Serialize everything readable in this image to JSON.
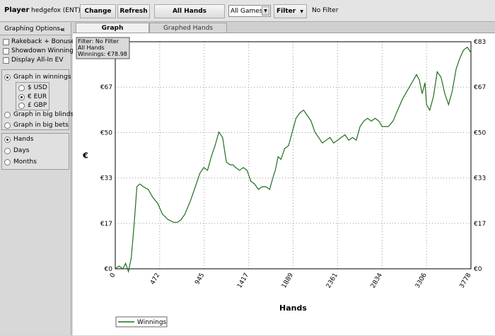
{
  "toolbar": {
    "player_label": "Player",
    "player_name": "hedgefox (ENT)",
    "change_label": "Change",
    "refresh_label": "Refresh",
    "hands_label": "All Hands",
    "games_select": "All Games",
    "filter_label": "Filter",
    "filter_status": "No Filter"
  },
  "sidebar": {
    "header": "Graphing Options",
    "collapse": "«",
    "checkboxes": [
      "Rakeback + Bonuses",
      "Showdown Winnings",
      "Display All-In EV"
    ],
    "graph_in": [
      {
        "label": "Graph in winnings",
        "selected": true
      },
      {
        "label": "Graph in big blinds",
        "selected": false
      },
      {
        "label": "Graph in big bets",
        "selected": false
      }
    ],
    "currency": [
      {
        "label": "$ USD",
        "selected": false
      },
      {
        "label": "€ EUR",
        "selected": true
      },
      {
        "label": "£ GBP",
        "selected": false
      }
    ],
    "period": [
      {
        "label": "Hands",
        "selected": true
      },
      {
        "label": "Days",
        "selected": false
      },
      {
        "label": "Months",
        "selected": false
      }
    ]
  },
  "tabs": [
    {
      "label": "Graph",
      "active": true
    },
    {
      "label": "Graphed Hands",
      "active": false
    }
  ],
  "info_box": {
    "line1": "Filter: No Filter",
    "line2": "All Hands",
    "line3": "Winnings: €78.98"
  },
  "chart_data": {
    "type": "line",
    "xlabel": "Hands",
    "ylabel": "€",
    "x_ticks": [
      0,
      472,
      945,
      1417,
      1889,
      2361,
      2834,
      3306,
      3778
    ],
    "y_ticks": [
      "€0",
      "€17",
      "€33",
      "€50",
      "€67",
      "€83"
    ],
    "xlim": [
      0,
      3778
    ],
    "ylim": [
      0,
      83
    ],
    "grid": true,
    "legend_position": "bottom-left",
    "line_color": "#1f6e1f",
    "series": [
      {
        "name": "Winnings",
        "x": [
          0,
          40,
          80,
          110,
          140,
          170,
          200,
          230,
          260,
          300,
          350,
          400,
          450,
          500,
          560,
          620,
          660,
          700,
          740,
          800,
          850,
          900,
          940,
          980,
          1020,
          1060,
          1100,
          1140,
          1180,
          1220,
          1250,
          1280,
          1320,
          1360,
          1400,
          1440,
          1480,
          1520,
          1560,
          1600,
          1640,
          1680,
          1700,
          1730,
          1760,
          1800,
          1840,
          1880,
          1920,
          1960,
          2000,
          2040,
          2080,
          2120,
          2160,
          2200,
          2240,
          2280,
          2320,
          2361,
          2400,
          2440,
          2480,
          2520,
          2560,
          2600,
          2640,
          2680,
          2720,
          2760,
          2800,
          2834,
          2870,
          2900,
          2950,
          3000,
          3050,
          3100,
          3150,
          3200,
          3230,
          3260,
          3290,
          3306,
          3340,
          3380,
          3420,
          3460,
          3500,
          3540,
          3580,
          3620,
          3660,
          3700,
          3740,
          3778
        ],
        "y": [
          0,
          1,
          0,
          2,
          -1,
          4,
          16,
          30,
          31,
          30,
          29,
          26,
          24,
          20,
          18,
          17,
          17,
          18,
          20,
          25,
          30,
          35,
          37,
          36,
          41,
          45,
          50,
          48,
          39,
          38,
          38,
          37,
          36,
          37,
          36,
          32,
          31,
          29,
          30,
          30,
          29,
          34,
          36,
          41,
          40,
          44,
          45,
          50,
          55,
          57,
          58,
          56,
          54,
          50,
          48,
          46,
          47,
          48,
          46,
          47,
          48,
          49,
          47,
          48,
          47,
          52,
          54,
          55,
          54,
          55,
          54,
          52,
          52,
          52,
          54,
          58,
          62,
          65,
          68,
          71,
          69,
          64,
          68,
          60,
          58,
          63,
          72,
          70,
          64,
          60,
          65,
          73,
          77,
          80,
          81,
          79
        ],
        "values_note": ""
      }
    ]
  }
}
